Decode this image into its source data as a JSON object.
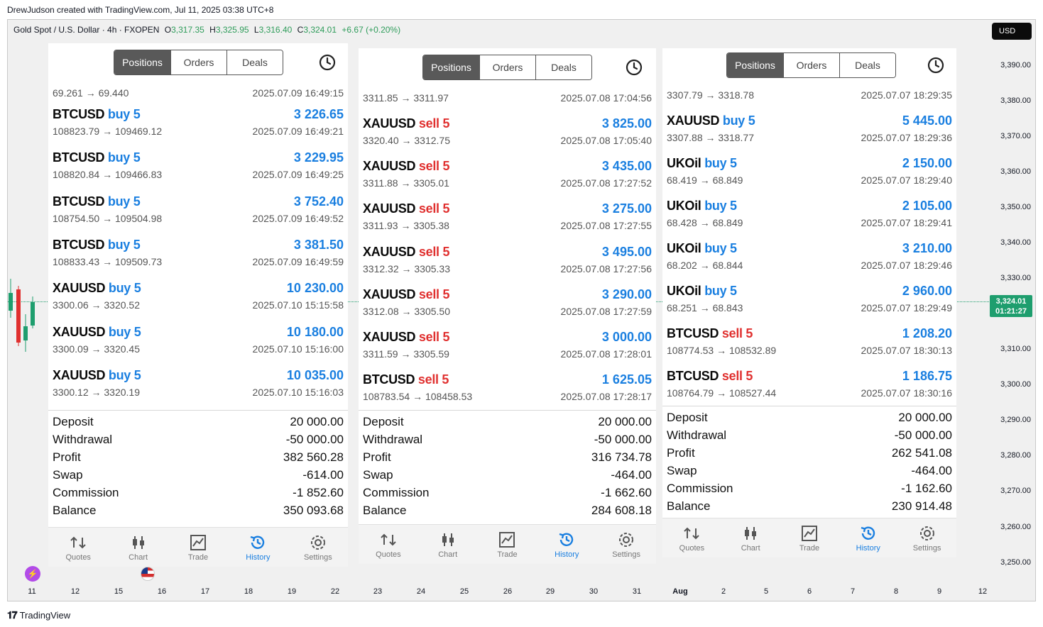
{
  "credit": "DrewJudson created with TradingView.com, Jul 11, 2025 03:38 UTC+8",
  "chart": {
    "symbol_line": "Gold Spot / U.S. Dollar · 4h · FXOPEN",
    "o_label": "O",
    "o_value": "3,317.35",
    "h_label": "H",
    "h_value": "3,325.95",
    "l_label": "L",
    "l_value": "3,316.40",
    "c_label": "C",
    "c_value": "3,324.01",
    "change": "+6.67 (+0.20%)",
    "currency": "USD",
    "current_price": "3,324.01",
    "countdown": "01:21:27",
    "price_ticks": [
      "3,390.00",
      "3,380.00",
      "3,370.00",
      "3,360.00",
      "3,350.00",
      "3,340.00",
      "3,330.00",
      "3,310.00",
      "3,300.00",
      "3,290.00",
      "3,280.00",
      "3,270.00",
      "3,260.00",
      "3,250.00"
    ],
    "time_ticks": [
      "11",
      "12",
      "15",
      "16",
      "17",
      "18",
      "19",
      "22",
      "23",
      "24",
      "25",
      "26",
      "29",
      "30",
      "31",
      "Aug",
      "2",
      "5",
      "6",
      "7",
      "8",
      "9",
      "12"
    ],
    "accent_up": "#1e9e6e",
    "accent_down": "#e0302f"
  },
  "panels": [
    {
      "tabs": [
        "Positions",
        "Orders",
        "Deals"
      ],
      "active_tab": "Positions",
      "partial": {
        "prices": "69.261 → 69.440",
        "dt": "2025.07.09 16:49:15"
      },
      "rows": [
        {
          "sym": "BTCUSD",
          "side": "buy 5",
          "dir": "buy",
          "profit": "3 226.65",
          "prices": "108823.79 → 109469.12",
          "dt": "2025.07.09 16:49:21"
        },
        {
          "sym": "BTCUSD",
          "side": "buy 5",
          "dir": "buy",
          "profit": "3 229.95",
          "prices": "108820.84 → 109466.83",
          "dt": "2025.07.09 16:49:25"
        },
        {
          "sym": "BTCUSD",
          "side": "buy 5",
          "dir": "buy",
          "profit": "3 752.40",
          "prices": "108754.50 → 109504.98",
          "dt": "2025.07.09 16:49:52"
        },
        {
          "sym": "BTCUSD",
          "side": "buy 5",
          "dir": "buy",
          "profit": "3 381.50",
          "prices": "108833.43 → 109509.73",
          "dt": "2025.07.09 16:49:59"
        },
        {
          "sym": "XAUUSD",
          "side": "buy 5",
          "dir": "buy",
          "profit": "10 230.00",
          "prices": "3300.06 → 3320.52",
          "dt": "2025.07.10 15:15:58"
        },
        {
          "sym": "XAUUSD",
          "side": "buy 5",
          "dir": "buy",
          "profit": "10 180.00",
          "prices": "3300.09 → 3320.45",
          "dt": "2025.07.10 15:16:00"
        },
        {
          "sym": "XAUUSD",
          "side": "buy 5",
          "dir": "buy",
          "profit": "10 035.00",
          "prices": "3300.12 → 3320.19",
          "dt": "2025.07.10 15:16:03"
        }
      ],
      "summary": [
        {
          "k": "Deposit",
          "v": "20 000.00"
        },
        {
          "k": "Withdrawal",
          "v": "-50 000.00"
        },
        {
          "k": "Profit",
          "v": "382 560.28"
        },
        {
          "k": "Swap",
          "v": "-614.00"
        },
        {
          "k": "Commission",
          "v": "-1 852.60"
        },
        {
          "k": "Balance",
          "v": "350 093.68"
        }
      ],
      "nav": [
        "Quotes",
        "Chart",
        "Trade",
        "History",
        "Settings"
      ]
    },
    {
      "tabs": [
        "Positions",
        "Orders",
        "Deals"
      ],
      "active_tab": "Positions",
      "partial": {
        "prices": "3311.85 → 3311.97",
        "dt": "2025.07.08 17:04:56"
      },
      "rows": [
        {
          "sym": "XAUUSD",
          "side": "sell 5",
          "dir": "sell",
          "profit": "3 825.00",
          "prices": "3320.40 → 3312.75",
          "dt": "2025.07.08 17:05:40"
        },
        {
          "sym": "XAUUSD",
          "side": "sell 5",
          "dir": "sell",
          "profit": "3 435.00",
          "prices": "3311.88 → 3305.01",
          "dt": "2025.07.08 17:27:52"
        },
        {
          "sym": "XAUUSD",
          "side": "sell 5",
          "dir": "sell",
          "profit": "3 275.00",
          "prices": "3311.93 → 3305.38",
          "dt": "2025.07.08 17:27:55"
        },
        {
          "sym": "XAUUSD",
          "side": "sell 5",
          "dir": "sell",
          "profit": "3 495.00",
          "prices": "3312.32 → 3305.33",
          "dt": "2025.07.08 17:27:56"
        },
        {
          "sym": "XAUUSD",
          "side": "sell 5",
          "dir": "sell",
          "profit": "3 290.00",
          "prices": "3312.08 → 3305.50",
          "dt": "2025.07.08 17:27:59"
        },
        {
          "sym": "XAUUSD",
          "side": "sell 5",
          "dir": "sell",
          "profit": "3 000.00",
          "prices": "3311.59 → 3305.59",
          "dt": "2025.07.08 17:28:01"
        },
        {
          "sym": "BTCUSD",
          "side": "sell 5",
          "dir": "sell",
          "profit": "1 625.05",
          "prices": "108783.54 → 108458.53",
          "dt": "2025.07.08 17:28:17"
        }
      ],
      "summary": [
        {
          "k": "Deposit",
          "v": "20 000.00"
        },
        {
          "k": "Withdrawal",
          "v": "-50 000.00"
        },
        {
          "k": "Profit",
          "v": "316 734.78"
        },
        {
          "k": "Swap",
          "v": "-464.00"
        },
        {
          "k": "Commission",
          "v": "-1 662.60"
        },
        {
          "k": "Balance",
          "v": "284 608.18"
        }
      ],
      "nav": [
        "Quotes",
        "Chart",
        "Trade",
        "History",
        "Settings"
      ]
    },
    {
      "tabs": [
        "Positions",
        "Orders",
        "Deals"
      ],
      "active_tab": "Positions",
      "partial": {
        "prices": "3307.79 → 3318.78",
        "dt": "2025.07.07 18:29:35"
      },
      "rows": [
        {
          "sym": "XAUUSD",
          "side": "buy 5",
          "dir": "buy",
          "profit": "5 445.00",
          "prices": "3307.88 → 3318.77",
          "dt": "2025.07.07 18:29:36"
        },
        {
          "sym": "UKOil",
          "side": "buy 5",
          "dir": "buy",
          "profit": "2 150.00",
          "prices": "68.419 → 68.849",
          "dt": "2025.07.07 18:29:40"
        },
        {
          "sym": "UKOil",
          "side": "buy 5",
          "dir": "buy",
          "profit": "2 105.00",
          "prices": "68.428 → 68.849",
          "dt": "2025.07.07 18:29:41"
        },
        {
          "sym": "UKOil",
          "side": "buy 5",
          "dir": "buy",
          "profit": "3 210.00",
          "prices": "68.202 → 68.844",
          "dt": "2025.07.07 18:29:46"
        },
        {
          "sym": "UKOil",
          "side": "buy 5",
          "dir": "buy",
          "profit": "2 960.00",
          "prices": "68.251 → 68.843",
          "dt": "2025.07.07 18:29:49"
        },
        {
          "sym": "BTCUSD",
          "side": "sell 5",
          "dir": "sell",
          "profit": "1 208.20",
          "prices": "108774.53 → 108532.89",
          "dt": "2025.07.07 18:30:13"
        },
        {
          "sym": "BTCUSD",
          "side": "sell 5",
          "dir": "sell",
          "profit": "1 186.75",
          "prices": "108764.79 → 108527.44",
          "dt": "2025.07.07 18:30:16"
        }
      ],
      "summary": [
        {
          "k": "Deposit",
          "v": "20 000.00"
        },
        {
          "k": "Withdrawal",
          "v": "-50 000.00"
        },
        {
          "k": "Profit",
          "v": "262 541.08"
        },
        {
          "k": "Swap",
          "v": "-464.00"
        },
        {
          "k": "Commission",
          "v": "-1 162.60"
        },
        {
          "k": "Balance",
          "v": "230 914.48"
        }
      ],
      "nav": [
        "Quotes",
        "Chart",
        "Trade",
        "History",
        "Settings"
      ]
    }
  ],
  "footer_brand": "TradingView"
}
